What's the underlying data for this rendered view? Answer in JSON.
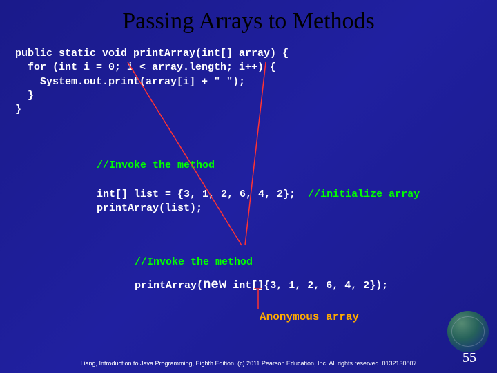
{
  "title": "Passing Arrays to Methods",
  "code": {
    "line1": "public static void printArray(int[] array) {",
    "line2": "  for (int i = 0; i < array.length; i++) {",
    "line3": "    System.out.print(array[i] + \" \");",
    "line4": "  }",
    "line5": "}"
  },
  "invoke1": {
    "comment": "//Invoke the method",
    "decl": "int[] list = {3, 1, 2, 6, 4, 2};",
    "init_comment": "//initialize array",
    "call": "printArray(list);"
  },
  "invoke2": {
    "comment": "//Invoke the method",
    "call_pre": "printArray(",
    "call_new": "new",
    "call_post": " int[]{3, 1, 2, 6, 4, 2});"
  },
  "anon_label": "Anonymous array",
  "footer": "Liang, Introduction to Java Programming, Eighth Edition, (c) 2011 Pearson Education, Inc. All rights reserved. 0132130807",
  "page": "55"
}
